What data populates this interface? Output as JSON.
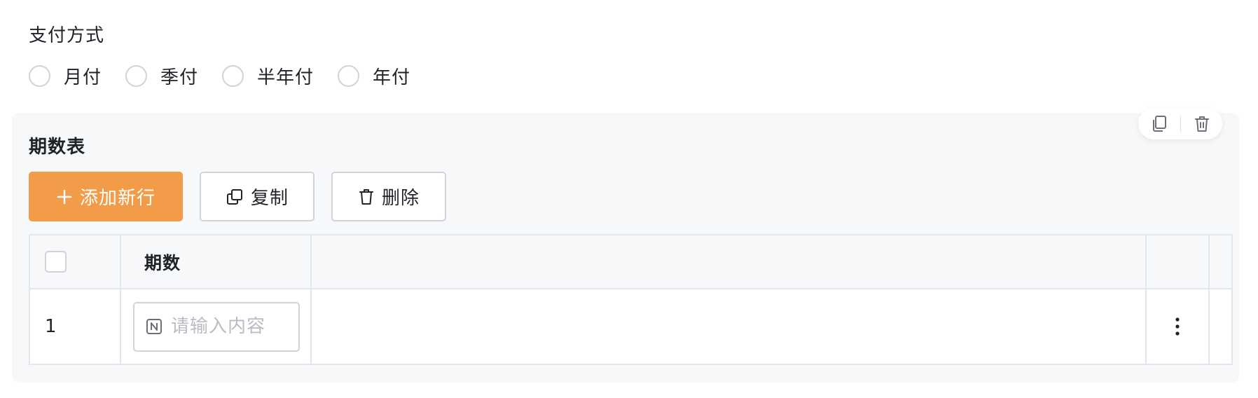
{
  "payment": {
    "title": "支付方式",
    "options": [
      {
        "label": "月付"
      },
      {
        "label": "季付"
      },
      {
        "label": "半年付"
      },
      {
        "label": "年付"
      }
    ]
  },
  "subform": {
    "title": "期数表",
    "toolbar": {
      "add_label": "添加新行",
      "copy_label": "复制",
      "delete_label": "删除"
    },
    "table": {
      "columns": [
        "期数"
      ],
      "rows": [
        {
          "index": "1",
          "placeholder": "请输入内容"
        }
      ]
    }
  },
  "colors": {
    "primary": "#f29c4a",
    "border": "#d0d3da",
    "panel_bg": "#f7f8fa"
  },
  "icons": [
    "copy-icon",
    "trash-icon",
    "plus-icon",
    "number-field-icon",
    "more-vertical-icon"
  ]
}
